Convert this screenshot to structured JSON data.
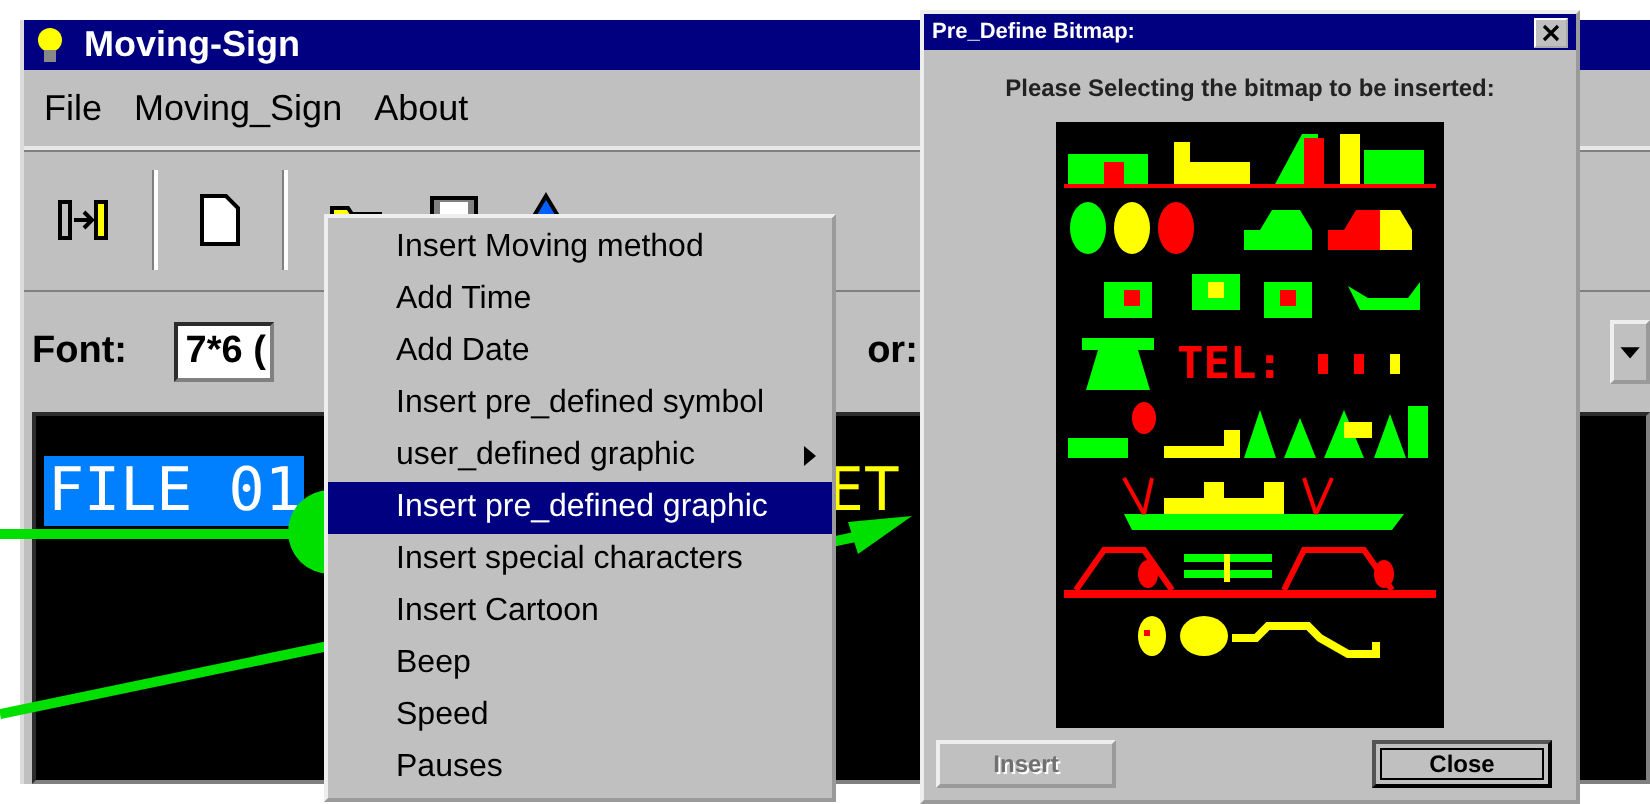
{
  "window": {
    "title": "Moving-Sign"
  },
  "menu_bar": [
    {
      "label": "File"
    },
    {
      "label": "Moving_Sign"
    },
    {
      "label": "About"
    }
  ],
  "font_row": {
    "label": "Font:",
    "font_value": "7*6 (",
    "color_label": "or:"
  },
  "editor": {
    "segments": [
      {
        "text": "FILE 01",
        "selected": true
      },
      {
        "text": "ET",
        "selected": false
      }
    ]
  },
  "context_menu": {
    "items": [
      {
        "label": "Insert Moving method",
        "selected": false,
        "submenu": false
      },
      {
        "label": "Add Time",
        "selected": false,
        "submenu": false
      },
      {
        "label": "Add Date",
        "selected": false,
        "submenu": false
      },
      {
        "label": "Insert pre_defined symbol",
        "selected": false,
        "submenu": false
      },
      {
        "label": "user_defined graphic",
        "selected": false,
        "submenu": true
      },
      {
        "label": "Insert pre_defined graphic",
        "selected": true,
        "submenu": false
      },
      {
        "label": "Insert special characters",
        "selected": false,
        "submenu": false
      },
      {
        "label": "Insert Cartoon",
        "selected": false,
        "submenu": false
      },
      {
        "label": "Beep",
        "selected": false,
        "submenu": false
      },
      {
        "label": "Speed",
        "selected": false,
        "submenu": false
      },
      {
        "label": "Pauses",
        "selected": false,
        "submenu": false
      }
    ]
  },
  "dialog": {
    "title": "Pre_Define Bitmap:",
    "prompt": "Please Selecting the bitmap to be inserted:",
    "bitmap_text": "TEL:",
    "buttons": [
      {
        "label": "Insert",
        "disabled": true
      },
      {
        "label": "Close",
        "disabled": false
      }
    ]
  }
}
